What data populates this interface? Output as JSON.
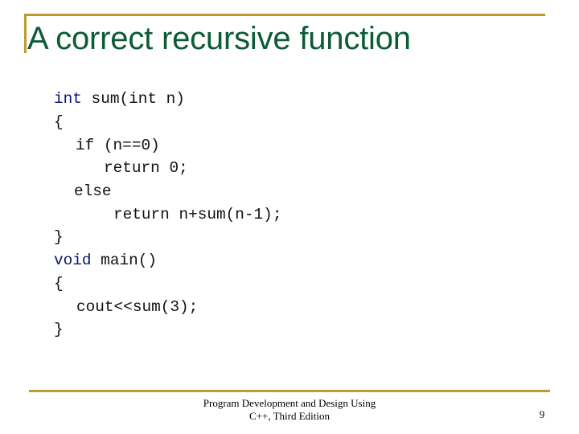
{
  "slide": {
    "title": "A correct recursive function",
    "code_lines": [
      {
        "keyword": "int",
        "rest": " sum(int n)"
      },
      {
        "keyword": "",
        "rest": "{"
      },
      {
        "keyword": "",
        "rest": "if (n==0)"
      },
      {
        "keyword": "",
        "rest": "return 0;"
      },
      {
        "keyword": "",
        "rest": "else"
      },
      {
        "keyword": "",
        "rest": "return n+sum(n-1);"
      },
      {
        "keyword": "",
        "rest": "}"
      },
      {
        "keyword": "void",
        "rest": " main()"
      },
      {
        "keyword": "",
        "rest": "{"
      },
      {
        "keyword": "",
        "rest": "cout<<sum(3);"
      },
      {
        "keyword": "",
        "rest": "}"
      }
    ],
    "footer": {
      "line1": "Program Development and Design Using",
      "line2": "C++, Third Edition",
      "page_number": "9"
    },
    "colors": {
      "accent_rule": "#c09a2a",
      "title": "#0b5b36",
      "keyword": "#0a1470",
      "code": "#111111"
    }
  }
}
